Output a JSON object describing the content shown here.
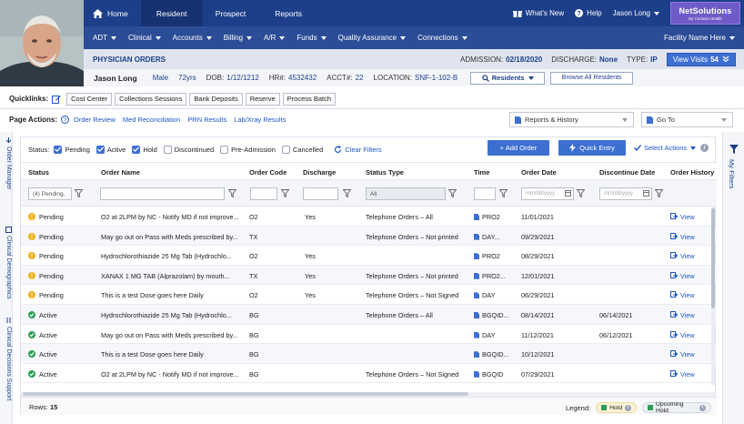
{
  "nav": {
    "tabs": [
      {
        "label": "Home"
      },
      {
        "label": "Resident"
      },
      {
        "label": "Prospect"
      },
      {
        "label": "Reports"
      }
    ],
    "whats_new": "What's New",
    "help": "Help",
    "user": "Jason Long",
    "brand": {
      "name": "NetSolutions",
      "tagline": "By Centara Health"
    }
  },
  "menu": {
    "items": [
      "ADT",
      "Clinical",
      "Accounts",
      "Billing",
      "A/R",
      "Funds",
      "Quality Assurance",
      "Connections"
    ],
    "facility": "Facility Name Here"
  },
  "orders_bar": {
    "title": "PHYSICIAN ORDERS",
    "admission_label": "ADMISSION:",
    "admission": "02/18/2020",
    "discharge_label": "DISCHARGE:",
    "discharge": "None",
    "type_label": "TYPE:",
    "type": "IP",
    "view_visits": "View Visits",
    "view_visits_count": "54"
  },
  "patient": {
    "name": "Jason Long",
    "sex": "Male",
    "age": "72yrs",
    "dob_label": "DOB:",
    "dob": "1/12/1212",
    "hr_label": "HR#:",
    "hr": "4532432",
    "acct_label": "ACCT#:",
    "acct": "22",
    "location_label": "LOCATION:",
    "location": "SNF-1-102-B",
    "residents": "Residents",
    "browse": "Browse All Residents"
  },
  "quicklinks": {
    "label": "Quicklinks:",
    "items": [
      "Cost Center",
      "Collections Sessions",
      "Bank Deposits",
      "Reserve",
      "Process Batch"
    ]
  },
  "page_actions": {
    "label": "Page Actions:",
    "links": [
      "Order Review",
      "Med Reconciliation",
      "PRN Results",
      "Lab/Xray Results"
    ],
    "reports_dropdown": "Reports & History",
    "goto_dropdown": "Go To"
  },
  "sidebar": {
    "left": [
      "Order Manager",
      "Clinical Demographics",
      "Clinical Decisions Support"
    ],
    "right": "My Filters"
  },
  "filters": {
    "status_label": "Status:",
    "checkboxes": [
      {
        "label": "Pending",
        "checked": true
      },
      {
        "label": "Active",
        "checked": true
      },
      {
        "label": "Hold",
        "checked": true
      },
      {
        "label": "Discontinued",
        "checked": false
      },
      {
        "label": "Pre-Admission",
        "checked": false
      },
      {
        "label": "Cancelled",
        "checked": false
      }
    ],
    "clear": "Clear Filters",
    "add_order": "+ Add Order",
    "quick_entry": "Quick Entry",
    "select_actions": "Select Actions"
  },
  "table": {
    "headers": [
      "Status",
      "Order Name",
      "Order Code",
      "Discharge",
      "Status Type",
      "Time",
      "Order Date",
      "Discontinue Date",
      "Order History"
    ],
    "status_filter": "(4) Pending,",
    "status_type_filter": "All",
    "date_placeholder": "mm/dd/yyyy",
    "rows": [
      {
        "status": "Pending",
        "name": "O2 at 2LPM by NC - Notify MD if not improve...",
        "code": "O2",
        "discharge": "Yes",
        "stype": "Telephone Orders – All",
        "time": "PRO2",
        "odate": "11/01/2021",
        "ddate": "",
        "hist": "View"
      },
      {
        "status": "Pending",
        "name": "May go out on Pass with Meds prescribed by...",
        "code": "TX",
        "discharge": "",
        "stype": "Telephone Orders – Not printed",
        "time": "DAY...",
        "odate": "09/29/2021",
        "ddate": "",
        "hist": "View"
      },
      {
        "status": "Pending",
        "name": "Hydrochlorothiazide 25 Mg Tab (Hydrochlo...",
        "code": "O2",
        "discharge": "Yes",
        "stype": "",
        "time": "PRO2",
        "odate": "08/29/2021",
        "ddate": "",
        "hist": "View"
      },
      {
        "status": "Pending",
        "name": "XANAX 1 MG TAB (Alprazolam) by mouth...",
        "code": "TX",
        "discharge": "Yes",
        "stype": "Telephone Orders – Not printed",
        "time": "PRO2...",
        "odate": "12/01/2021",
        "ddate": "",
        "hist": "View"
      },
      {
        "status": "Pending",
        "name": "This is a test Dose goes here Daily",
        "code": "O2",
        "discharge": "Yes",
        "stype": "Telephone Orders – Not Signed",
        "time": "DAY",
        "odate": "06/29/2021",
        "ddate": "",
        "hist": "View"
      },
      {
        "status": "Active",
        "name": "Hydrochlorothiazide 25 Mg Tab (Hydrochlo...",
        "code": "BG",
        "discharge": "",
        "stype": "Telephone Orders – All",
        "time": "BGQID...",
        "odate": "08/14/2021",
        "ddate": "06/14/2021",
        "hist": "View"
      },
      {
        "status": "Active",
        "name": "May go out on Pass with Meds prescribed by...",
        "code": "BG",
        "discharge": "",
        "stype": "",
        "time": "DAY",
        "odate": "11/12/2021",
        "ddate": "06/12/2021",
        "hist": "View"
      },
      {
        "status": "Active",
        "name": "This is a test Dose goes here Daily",
        "code": "BG",
        "discharge": "",
        "stype": "",
        "time": "BGQID...",
        "odate": "10/12/2021",
        "ddate": "",
        "hist": "View"
      },
      {
        "status": "Active",
        "name": "O2 at 2LPM by NC - Notify MD if not improve...",
        "code": "BG",
        "discharge": "",
        "stype": "Telephone Orders – Not Signed",
        "time": "BGQID",
        "odate": "07/29/2021",
        "ddate": "",
        "hist": "View"
      }
    ]
  },
  "footer": {
    "rows_label": "Rows:",
    "rows_count": "15",
    "legend_label": "Legend:",
    "hold": "Hold",
    "upcoming_hold": "Upcoming Hold"
  },
  "colors": {
    "nav": "#1d3f8a",
    "accent": "#3d6fd1",
    "pending": "#f2b21b",
    "active": "#2e9d57",
    "brand": "#6f5bc7"
  }
}
